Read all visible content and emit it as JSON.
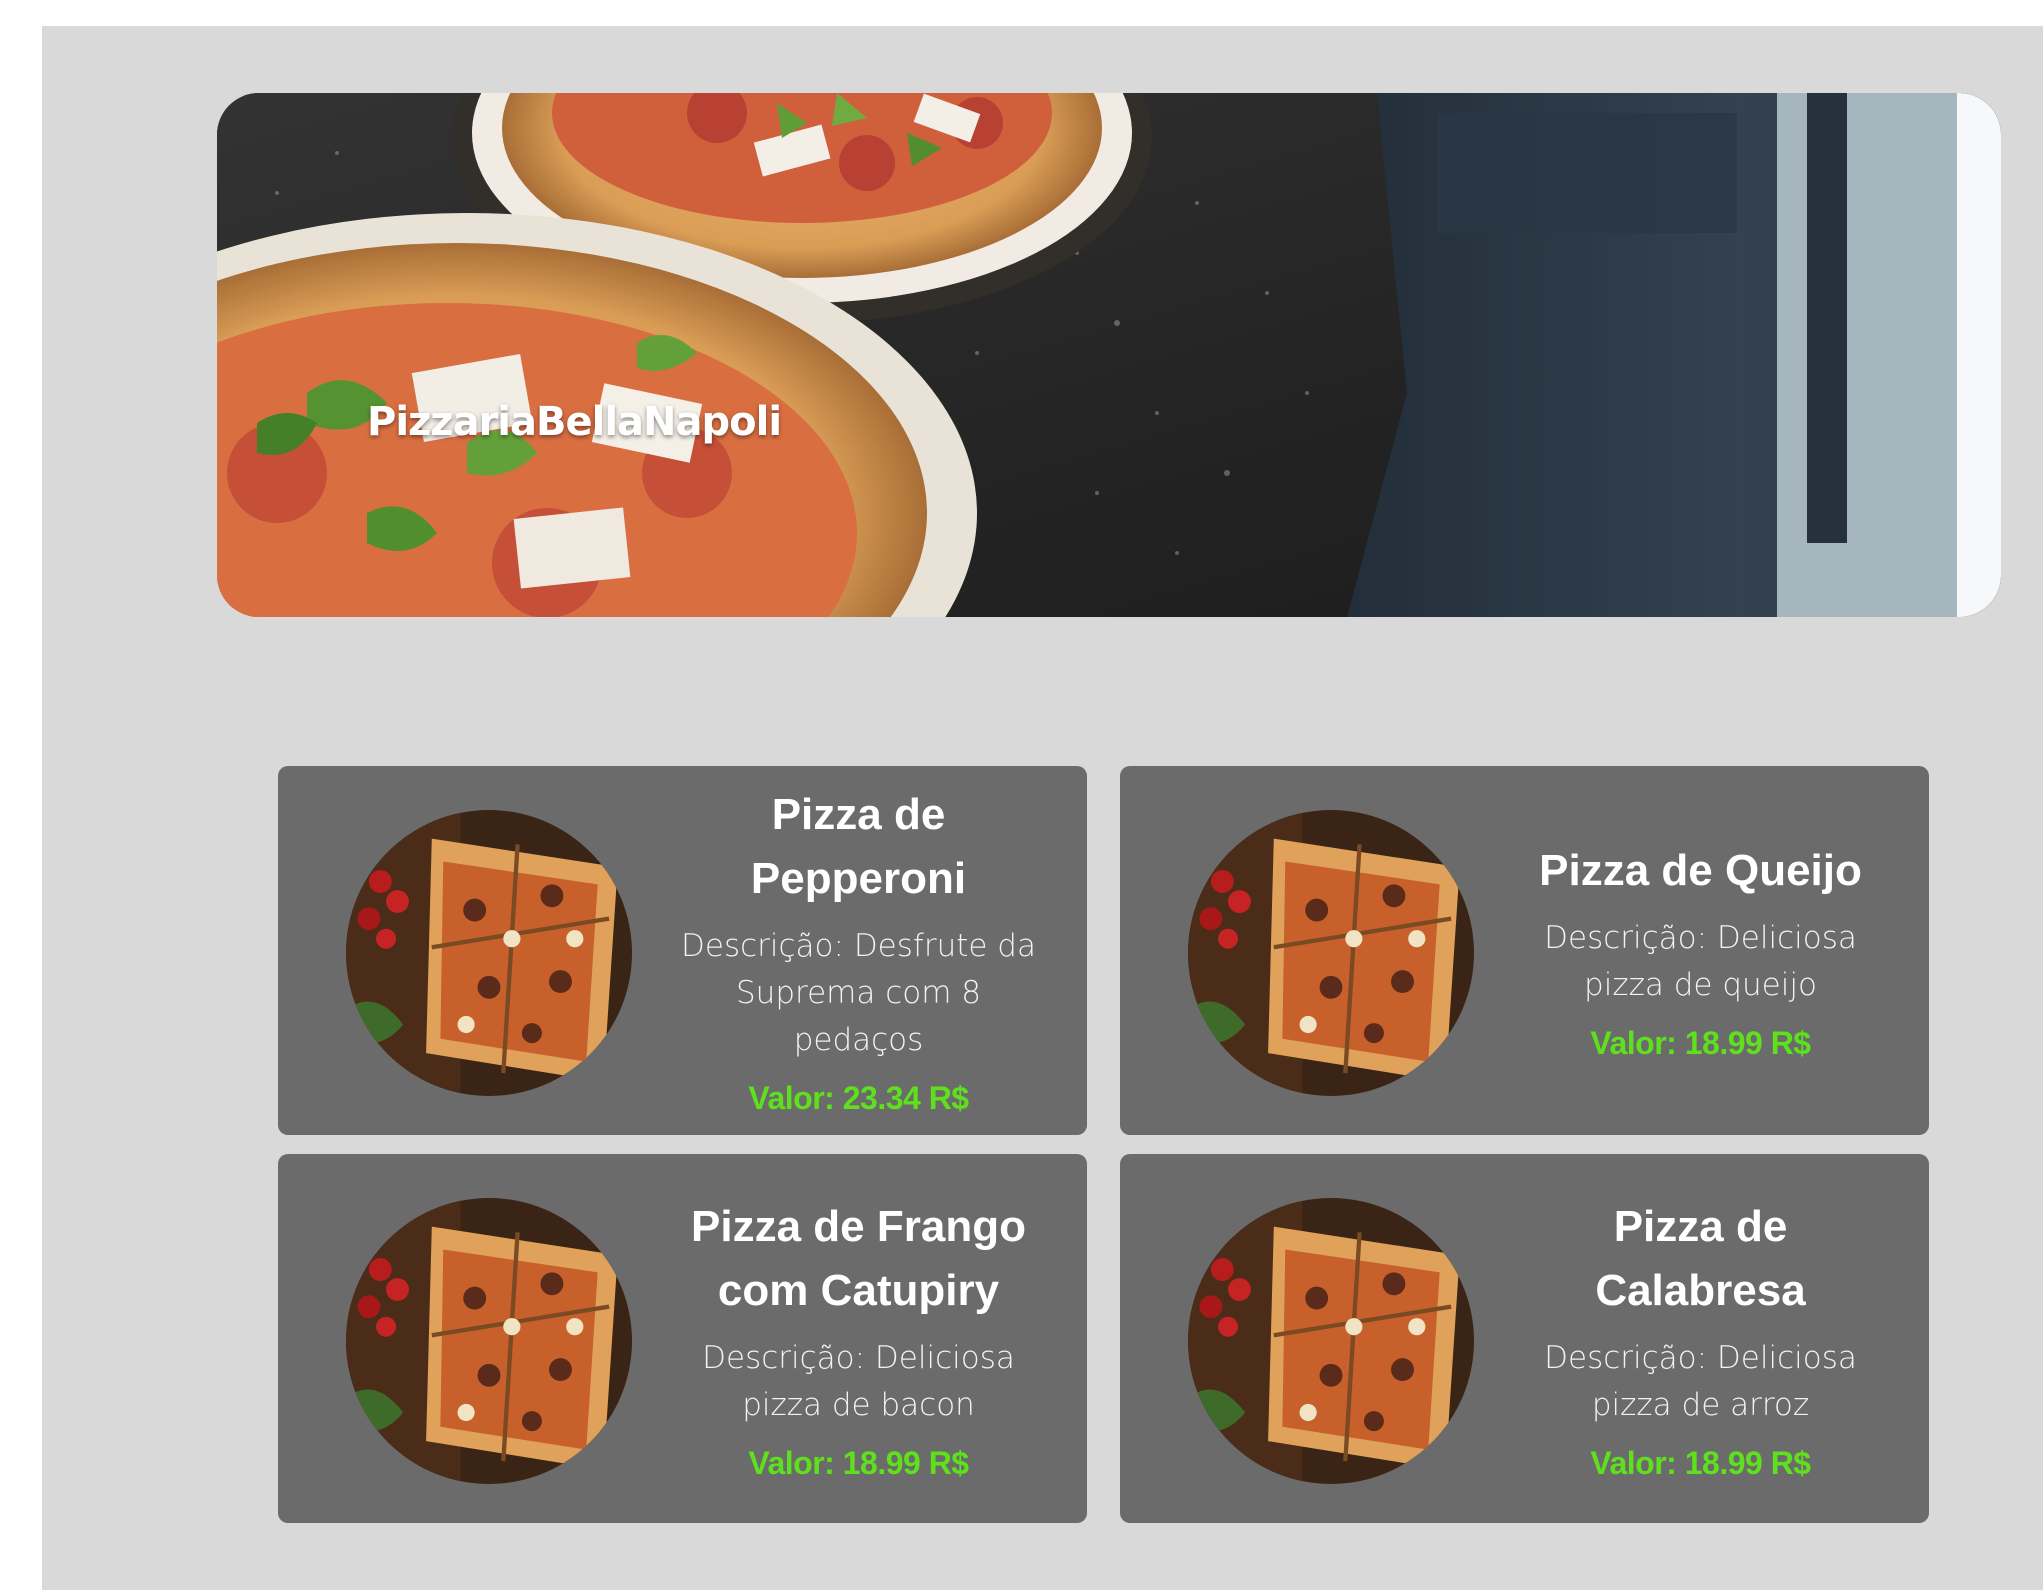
{
  "header": {
    "brand_title": "PizzariaBellaNapoli"
  },
  "menu": {
    "items": [
      {
        "title": "Pizza de Pepperoni",
        "description": "Descrição: Desfrute da Suprema com 8 pedaços",
        "price": "Valor: 23.34 R$"
      },
      {
        "title": "Pizza de Queijo",
        "description": "Descrição: Deliciosa pizza de queijo",
        "price": "Valor: 18.99 R$"
      },
      {
        "title": "Pizza de Frango com Catupiry",
        "description": "Descrição: Deliciosa pizza de bacon",
        "price": "Valor: 18.99 R$"
      },
      {
        "title": "Pizza de Calabresa",
        "description": "Descrição: Deliciosa pizza de arroz",
        "price": "Valor: 18.99 R$"
      }
    ]
  },
  "colors": {
    "page_background": "#d9d9d9",
    "card_background": "#6b6b6b",
    "price_green": "#5ee01d",
    "title_white": "#ffffff"
  }
}
